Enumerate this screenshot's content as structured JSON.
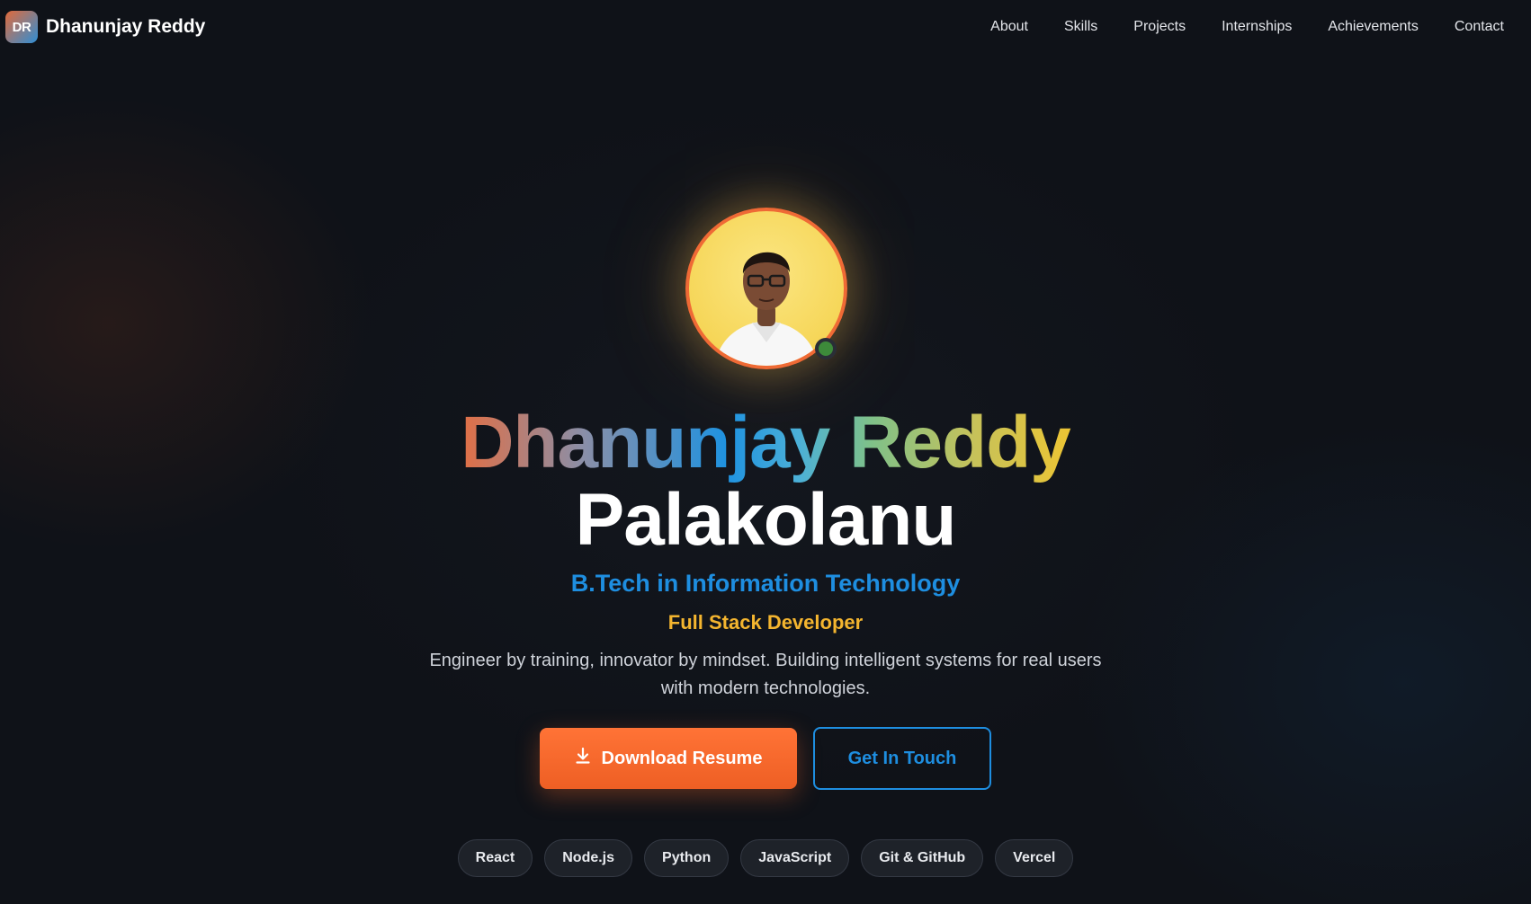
{
  "brand": {
    "initials": "DR",
    "name": "Dhanunjay Reddy"
  },
  "nav": {
    "items": [
      {
        "label": "About"
      },
      {
        "label": "Skills"
      },
      {
        "label": "Projects"
      },
      {
        "label": "Internships"
      },
      {
        "label": "Achievements"
      },
      {
        "label": "Contact"
      }
    ]
  },
  "hero": {
    "name_line1": "Dhanunjay Reddy",
    "name_line2": "Palakolanu",
    "degree": "B.Tech in Information Technology",
    "role": "Full Stack Developer",
    "tagline": "Engineer by training, innovator by mindset. Building intelligent systems for real users with modern technologies.",
    "primary_button": "Download Resume",
    "secondary_button": "Get In Touch",
    "status": "online"
  },
  "skills": [
    "React",
    "Node.js",
    "Python",
    "JavaScript",
    "Git & GitHub",
    "Vercel"
  ],
  "colors": {
    "accent_orange": "#ef6a35",
    "accent_blue": "#1e8ee0",
    "accent_yellow": "#f4b52f",
    "status_green": "#3d8a3a",
    "background": "#0f1218"
  },
  "icons": {
    "download": "download-icon"
  }
}
